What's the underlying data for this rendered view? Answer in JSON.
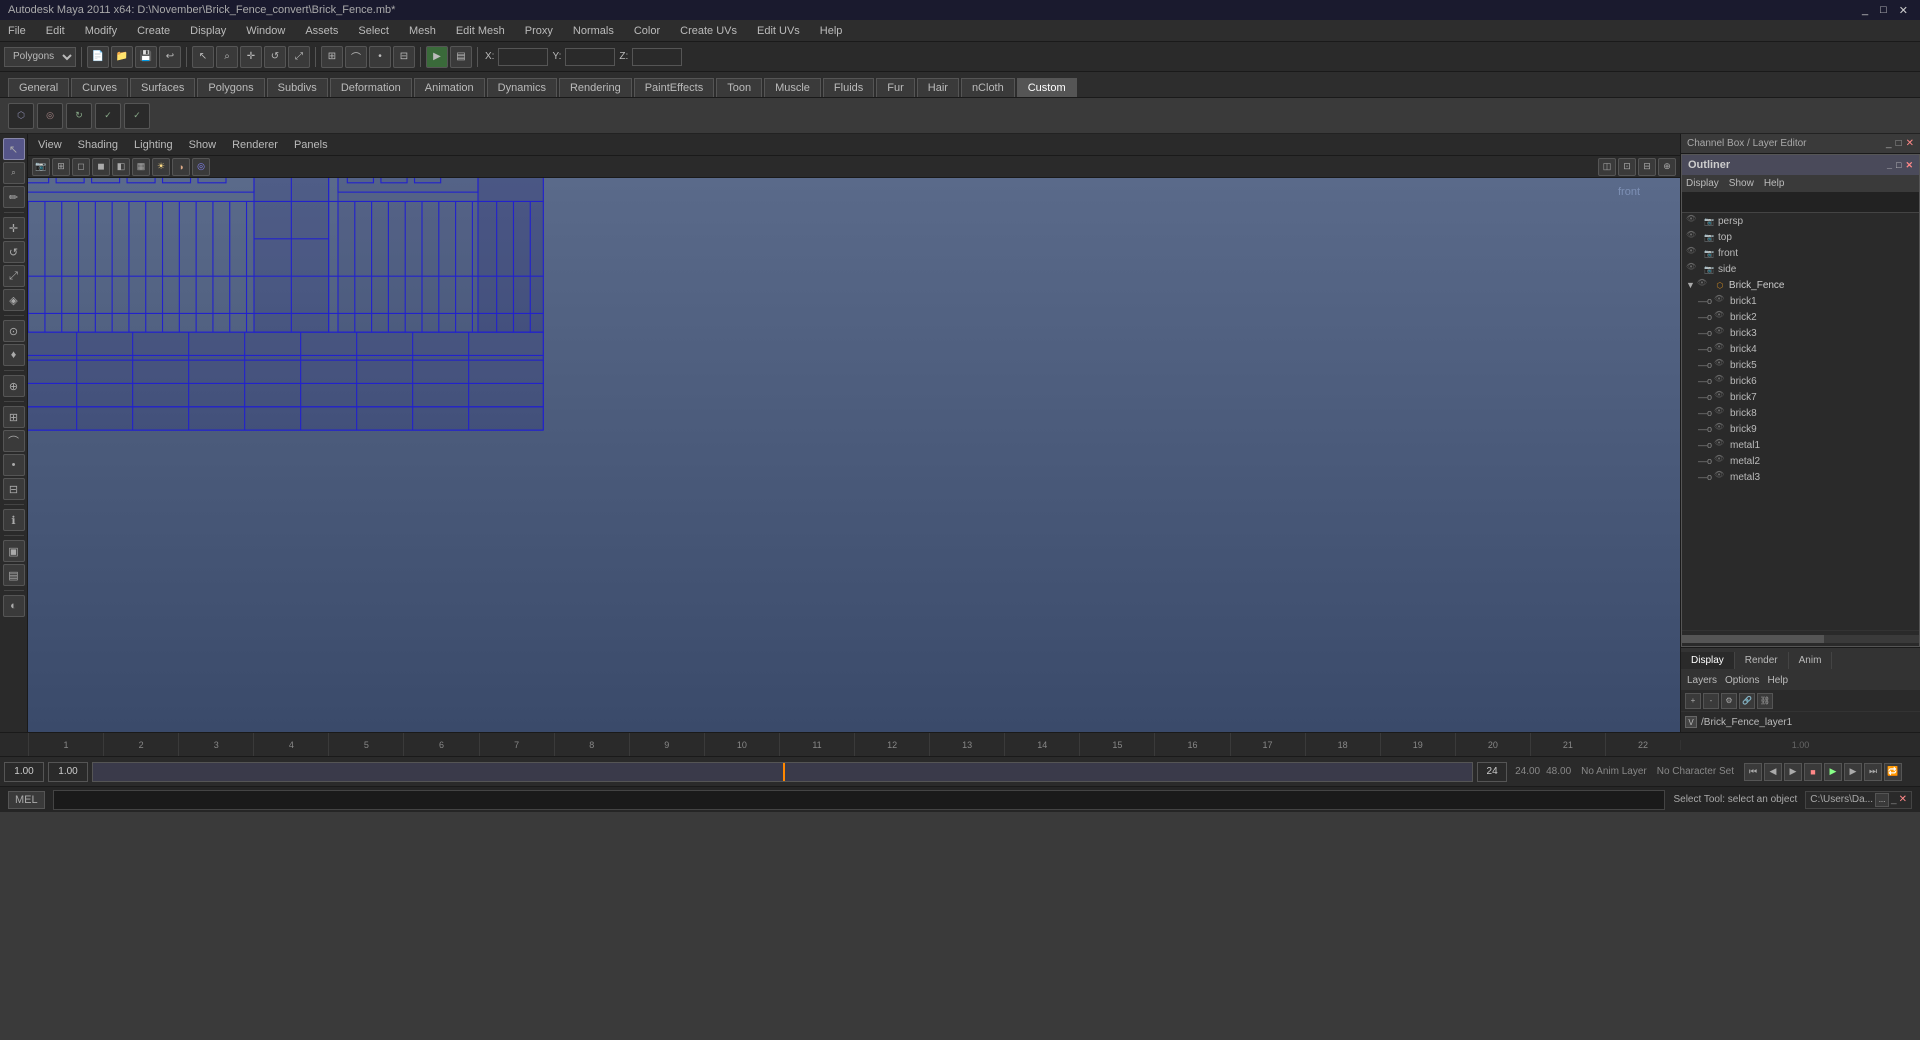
{
  "app": {
    "title": "Autodesk Maya 2011 x64: D:\\November\\Brick_Fence_convert\\Brick_Fence.mb*",
    "title_short": "Autodesk Maya 2011 x64: D:\\November\\Brick_Fence_convert\\Brick_Fence.mb*"
  },
  "title_bar": {
    "controls": [
      "_",
      "□",
      "✕"
    ]
  },
  "menu_bar": {
    "items": [
      "File",
      "Edit",
      "Modify",
      "Create",
      "Display",
      "Window",
      "Assets",
      "Select",
      "Mesh",
      "Edit Mesh",
      "Proxy",
      "Normals",
      "Color",
      "Create UVs",
      "Edit UVs",
      "Help"
    ]
  },
  "toolbar": {
    "workspace_label": "Polygons",
    "x_label": "X:",
    "y_label": "Y:",
    "z_label": "Z:"
  },
  "shelf": {
    "tabs": [
      "General",
      "Curves",
      "Surfaces",
      "Polygons",
      "Subdivs",
      "Deformation",
      "Animation",
      "Dynamics",
      "Rendering",
      "PaintEffects",
      "Toon",
      "Muscle",
      "Fluids",
      "Fur",
      "Hair",
      "nCloth",
      "Custom"
    ],
    "active_tab": "Custom"
  },
  "viewport": {
    "menus": [
      "View",
      "Shading",
      "Lighting",
      "Show",
      "Renderer",
      "Panels"
    ],
    "front_label": "front",
    "bg_color_top": "#5a6a8a",
    "bg_color_bottom": "#3a4a6a",
    "fence_color": "#1a1aaa"
  },
  "outliner": {
    "title": "Outliner",
    "menus": [
      "Display",
      "Show",
      "Help"
    ],
    "items": [
      {
        "name": "persp",
        "indent": 0,
        "icon": "cam"
      },
      {
        "name": "top",
        "indent": 0,
        "icon": "cam"
      },
      {
        "name": "front",
        "indent": 0,
        "icon": "cam"
      },
      {
        "name": "side",
        "indent": 0,
        "icon": "cam"
      },
      {
        "name": "Brick_Fence",
        "indent": 0,
        "icon": "grp",
        "expanded": true
      },
      {
        "name": "brick1",
        "indent": 1,
        "icon": "mesh"
      },
      {
        "name": "brick2",
        "indent": 1,
        "icon": "mesh"
      },
      {
        "name": "brick3",
        "indent": 1,
        "icon": "mesh"
      },
      {
        "name": "brick4",
        "indent": 1,
        "icon": "mesh"
      },
      {
        "name": "brick5",
        "indent": 1,
        "icon": "mesh"
      },
      {
        "name": "brick6",
        "indent": 1,
        "icon": "mesh"
      },
      {
        "name": "brick7",
        "indent": 1,
        "icon": "mesh"
      },
      {
        "name": "brick8",
        "indent": 1,
        "icon": "mesh"
      },
      {
        "name": "brick9",
        "indent": 1,
        "icon": "mesh"
      },
      {
        "name": "metal1",
        "indent": 1,
        "icon": "mesh"
      },
      {
        "name": "metal2",
        "indent": 1,
        "icon": "mesh"
      },
      {
        "name": "metal3",
        "indent": 1,
        "icon": "mesh"
      }
    ]
  },
  "channel_box": {
    "title": "Channel Box / Layer Editor"
  },
  "bottom_tabs": {
    "tabs": [
      "Display",
      "Render",
      "Anim"
    ],
    "active": "Display"
  },
  "layers": {
    "header_items": [
      "Layers",
      "Options",
      "Help"
    ],
    "layer_name": "/Brick_Fence_layer1",
    "v_label": "V"
  },
  "anim": {
    "start": "1.00",
    "end": "1.00",
    "current": "1",
    "range_end": "24",
    "total1": "24.00",
    "total2": "48.00",
    "no_anim_layer": "No Anim Layer",
    "no_char_set": "No Character Set"
  },
  "status": {
    "mel_label": "MEL",
    "command_placeholder": "",
    "status_text": "Select Tool: select an object",
    "path_label": "C:\\Users\\Da..."
  },
  "left_tools": [
    {
      "name": "select",
      "icon": "↖",
      "active": true
    },
    {
      "name": "lasso",
      "icon": "⌕"
    },
    {
      "name": "paint",
      "icon": "✏"
    },
    {
      "name": "move",
      "icon": "✛"
    },
    {
      "name": "rotate",
      "icon": "↺"
    },
    {
      "name": "scale",
      "icon": "⤢"
    },
    {
      "name": "universal",
      "icon": "◈"
    },
    {
      "name": "soft-mod",
      "icon": "⊙"
    },
    {
      "name": "sculpt",
      "icon": "♦"
    },
    {
      "name": "show-manip",
      "icon": "⊕"
    },
    {
      "name": "snap-grid",
      "icon": "⊞"
    },
    {
      "name": "snap-curve",
      "icon": "⌒"
    },
    {
      "name": "snap-point",
      "icon": "•"
    },
    {
      "name": "snap-view",
      "icon": "⊟"
    },
    {
      "name": "info",
      "icon": "ℹ"
    },
    {
      "name": "render",
      "icon": "▣"
    },
    {
      "name": "ipr",
      "icon": "▤"
    },
    {
      "name": "silhouette",
      "icon": "◐"
    }
  ]
}
